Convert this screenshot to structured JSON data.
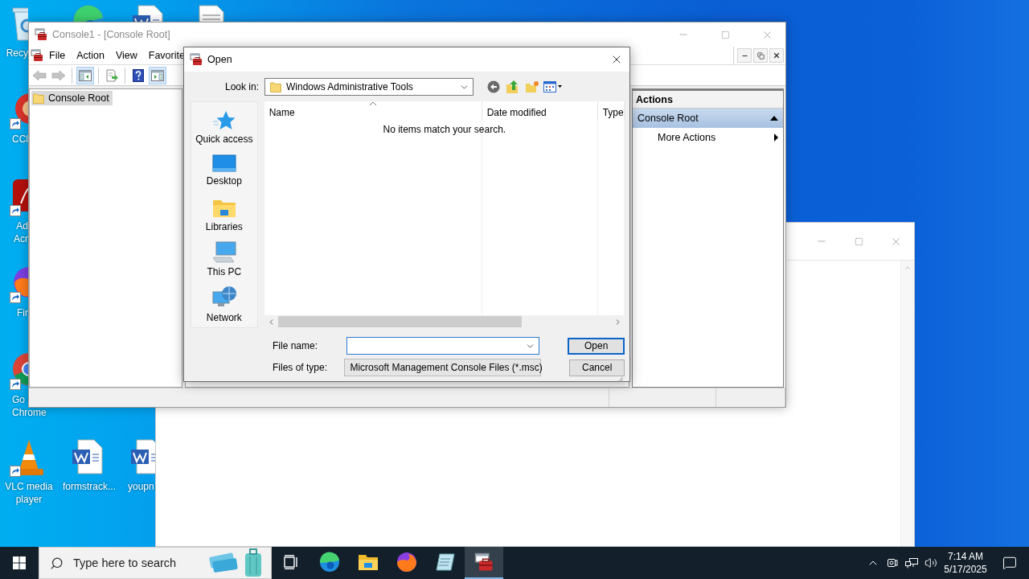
{
  "desktop_icons": [
    {
      "kind": "recycle-bin",
      "label": [
        "Recy"
      ],
      "shortcut": false
    },
    {
      "kind": "edge",
      "shortcut": false
    },
    {
      "kind": "word-doc",
      "shortcut": false
    },
    {
      "kind": "text-doc",
      "shortcut": false
    },
    {
      "kind": "ccleaner",
      "label": [
        "CCl"
      ],
      "shortcut": true
    },
    {
      "kind": "acrobat",
      "label": [
        "Ad",
        "Acr"
      ],
      "shortcut": true
    },
    {
      "kind": "firefox",
      "label": [
        "Fir"
      ],
      "shortcut": true
    },
    {
      "kind": "chrome",
      "label": [
        "Go",
        "Chrome"
      ],
      "shortcut": true
    },
    {
      "kind": "vlc",
      "label": [
        "VLC media",
        "player"
      ],
      "shortcut": true
    },
    {
      "kind": "word-doc",
      "label": [
        "formstrack..."
      ],
      "shortcut": false
    },
    {
      "kind": "word-doc",
      "label": [
        "youpn"
      ],
      "shortcut": false
    }
  ],
  "console": {
    "title": "Console1 - [Console Root]",
    "menu": [
      "File",
      "Action",
      "View",
      "Favorite"
    ],
    "toolbar_groups": [
      {
        "buttons": [
          {
            "kind": "back",
            "on": false,
            "disabled": true
          },
          {
            "kind": "forward",
            "on": false,
            "disabled": true
          }
        ]
      },
      {
        "buttons": [
          {
            "kind": "tree-toggle",
            "on": true,
            "disabled": false
          }
        ]
      },
      {
        "buttons": [
          {
            "kind": "export",
            "on": false,
            "disabled": false
          }
        ]
      },
      {
        "buttons": [
          {
            "kind": "help",
            "on": false,
            "disabled": false
          },
          {
            "kind": "pane-toggle",
            "on": true,
            "disabled": false
          }
        ]
      }
    ],
    "tree": [
      {
        "label": "Console Root",
        "selected": true
      }
    ],
    "actions": {
      "header": "Actions",
      "section": {
        "label": "Console Root",
        "expanded": true
      },
      "items": [
        {
          "label": "More Actions"
        }
      ]
    }
  },
  "dialog": {
    "title": "Open",
    "look_in_label": "Look in:",
    "look_in": "Windows Administrative Tools",
    "places": [
      {
        "kind": "quick-access",
        "label": "Quick access"
      },
      {
        "kind": "desktop",
        "label": "Desktop"
      },
      {
        "kind": "libraries",
        "label": "Libraries"
      },
      {
        "kind": "this-pc",
        "label": "This PC"
      },
      {
        "kind": "network",
        "label": "Network"
      }
    ],
    "columns": [
      {
        "label": "Name",
        "sorted": true
      },
      {
        "label": "Date modified",
        "sorted": false
      },
      {
        "label": "Type",
        "sorted": false
      }
    ],
    "empty_message": "No items match your search.",
    "file_name_label": "File name:",
    "file_type_label": "Files of type:",
    "file_type": "Microsoft Management Console Files (*.msc)",
    "buttons": [
      {
        "label": "Open",
        "default": true
      },
      {
        "label": "Cancel",
        "default": false
      }
    ]
  },
  "taskbar": {
    "search_placeholder": "Type here to search",
    "apps": [
      {
        "kind": "task-view",
        "selected": false
      },
      {
        "kind": "edge",
        "selected": false
      },
      {
        "kind": "explorer",
        "selected": false
      },
      {
        "kind": "firefox",
        "selected": false
      },
      {
        "kind": "notepad",
        "selected": false
      },
      {
        "kind": "mmc",
        "selected": true
      }
    ],
    "time": "7:14 AM",
    "date": "5/17/2025"
  }
}
